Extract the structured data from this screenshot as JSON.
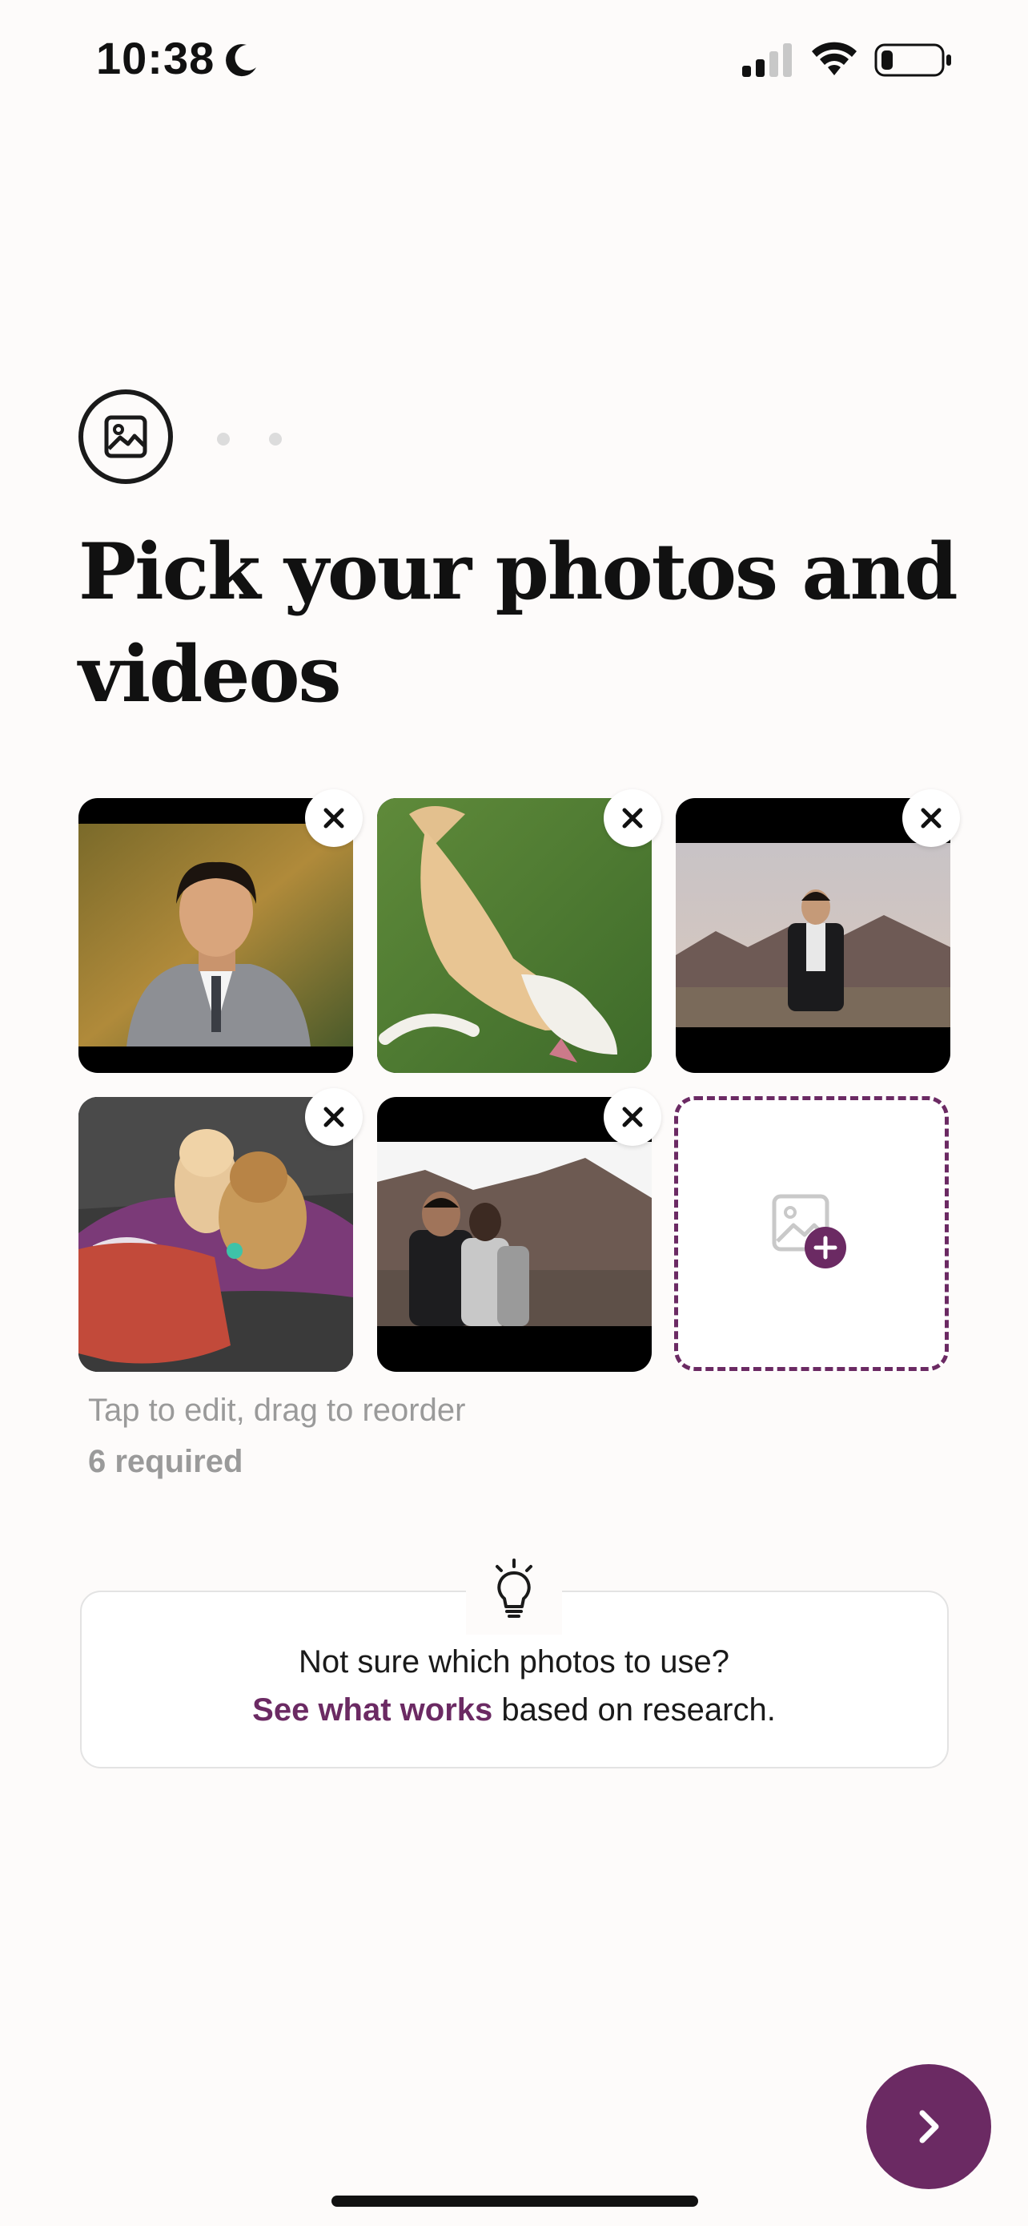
{
  "status_bar": {
    "time": "10:38",
    "icons": [
      "moon-icon",
      "cellular-signal-icon",
      "wifi-icon",
      "battery-icon"
    ]
  },
  "step_indicator": {
    "icon": "photo-icon",
    "total_steps": 3,
    "current_step": 1
  },
  "title": "Pick your photos and videos",
  "photos": [
    {
      "name": "photo-1",
      "description_icon": "portrait-photo",
      "remove_icon": "close-icon"
    },
    {
      "name": "photo-2",
      "description_icon": "dog-photo",
      "remove_icon": "close-icon"
    },
    {
      "name": "photo-3",
      "description_icon": "desert-portrait-photo",
      "remove_icon": "close-icon"
    },
    {
      "name": "photo-4",
      "description_icon": "puppies-photo",
      "remove_icon": "close-icon"
    },
    {
      "name": "photo-5",
      "description_icon": "group-desert-photo",
      "remove_icon": "close-icon"
    }
  ],
  "add_tile": {
    "icon": "add-photo-icon"
  },
  "hint": "Tap to edit, drag to reorder",
  "required": "6 required",
  "tip": {
    "icon": "lightbulb-icon",
    "line1": "Not sure which photos to use?",
    "link": "See what works",
    "line2_rest": " based on research."
  },
  "next_button": {
    "icon": "chevron-right-icon"
  },
  "colors": {
    "accent": "#6b2a63",
    "text": "#111111",
    "muted": "#9a9a9a",
    "background": "#fdfbfa"
  }
}
